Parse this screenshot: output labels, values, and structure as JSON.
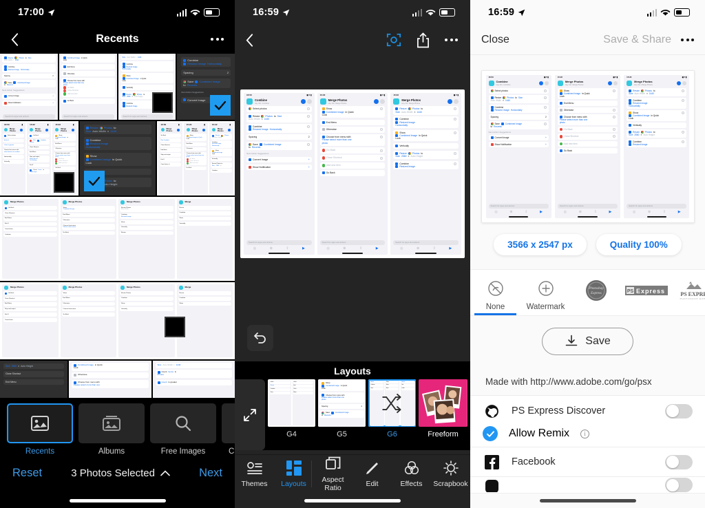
{
  "panel1": {
    "statusbar": {
      "time": "17:00",
      "location_icon": "location-arrow-icon",
      "signal_icon": "cellular-bars-icon",
      "wifi_icon": "wifi-icon",
      "battery_icon": "battery-icon"
    },
    "navbar": {
      "back_icon": "chevron-left-icon",
      "title": "Recents",
      "more_icon": "ellipsis-icon"
    },
    "tabs": [
      {
        "label": "Recents",
        "icon": "photos-icon",
        "selected": true
      },
      {
        "label": "Albums",
        "icon": "albums-icon",
        "selected": false
      },
      {
        "label": "Free Images",
        "icon": "search-icon",
        "selected": false
      },
      {
        "label": "Creative Cloud",
        "icon": "creative-cloud-icon",
        "selected": false
      }
    ],
    "actions": {
      "reset": "Reset",
      "selection": "3 Photos Selected",
      "chevron_icon": "chevron-up-icon",
      "next": "Next"
    }
  },
  "panel2": {
    "statusbar": {
      "time": "16:59"
    },
    "navbar": {
      "back_icon": "chevron-left-icon",
      "focus_icon": "focus-scan-icon",
      "share_icon": "share-icon",
      "more_icon": "ellipsis-icon"
    },
    "undo_icon": "undo-icon",
    "expand_icon": "expand-icon",
    "layouts_title": "Layouts",
    "layouts": [
      {
        "label": "G4",
        "selected": false
      },
      {
        "label": "G5",
        "selected": false
      },
      {
        "label": "G6",
        "selected": true
      },
      {
        "label": "Freeform",
        "selected": false
      }
    ],
    "bottom_nav": [
      {
        "label": "Themes",
        "icon": "themes-icon",
        "active": false
      },
      {
        "label": "Layouts",
        "icon": "layouts-icon",
        "active": true
      },
      {
        "label": "Aspect Ratio",
        "icon": "aspect-ratio-icon",
        "active": false
      },
      {
        "label": "Edit",
        "icon": "pencil-icon",
        "active": false
      },
      {
        "label": "Effects",
        "icon": "effects-icon",
        "active": false
      },
      {
        "label": "Scrapbook",
        "icon": "scrapbook-icon",
        "active": false
      }
    ]
  },
  "panel3": {
    "statusbar": {
      "time": "16:59"
    },
    "navbar": {
      "close": "Close",
      "save_share": "Save & Share",
      "more_icon": "ellipsis-icon"
    },
    "chips": [
      "3566 x 2547 px",
      "Quality 100%"
    ],
    "watermarks": [
      {
        "label": "None",
        "icon": "no-watermark-icon",
        "selected": true
      },
      {
        "label": "Watermark",
        "icon": "plus-circle-icon",
        "selected": false
      },
      {
        "label": "Photoshop Express",
        "icon": "ps-badge-icon",
        "selected": false
      },
      {
        "label": "PS Express",
        "icon": "ps-express-box-icon",
        "selected": false
      },
      {
        "label": "PS EXPRESS",
        "icon": "ps-express-mountain-icon",
        "selected": false
      }
    ],
    "save_button": {
      "label": "Save",
      "icon": "download-icon"
    },
    "made_with": "Made with http://www.adobe.com/go/psx",
    "share_rows": [
      {
        "label": "PS Express Discover",
        "icon": "globe-icon",
        "toggle": "off",
        "sub": {
          "label": "Allow Remix",
          "check_icon": "check-circle-icon",
          "info_icon": "info-icon"
        }
      },
      {
        "label": "Facebook",
        "icon": "facebook-icon",
        "toggle": "off"
      }
    ]
  },
  "colors": {
    "accent_blue": "#2196f3",
    "link_blue": "#3d9ae8",
    "chip_blue": "#1473e6",
    "dark_bg": "#000000",
    "panel2_bg": "#242424",
    "light_bg": "#fafafa"
  },
  "shortcuts": {
    "s1": {
      "time": "16:50",
      "title": "Combine",
      "subtitle": "Hey Siri, Combine",
      "rows": [
        [
          "Select photos"
        ],
        [
          "Resize",
          "Photos",
          "to",
          "Size",
          "Auto Width",
          "1440"
        ],
        [
          "Combine",
          "Resized Image",
          "Horizontally"
        ],
        [
          "Spacing",
          "2"
        ],
        [
          "Save",
          "Combined Image",
          "to",
          "Recents"
        ]
      ],
      "suggest_label": "Next Action Suggestions",
      "suggestions": [
        "Convert Image",
        "Show Notification"
      ],
      "search": "Search for apps and actions"
    },
    "s2": {
      "time": "15:22",
      "title": "Merge Photos",
      "subtitle": "Hey Siri, Merge Photos",
      "rows": [
        [
          "Show",
          "Combined Image",
          "in Quick Look"
        ],
        [
          "End Menu"
        ],
        [
          "Otherwise"
        ],
        [
          "Choose from menu with",
          "Please select more than one photo"
        ],
        [
          "Go Back"
        ],
        [
          "Close Shortcut"
        ],
        [
          "Add new item"
        ],
        [
          "Go Back"
        ]
      ],
      "search": "Search for apps and actions"
    },
    "s3": {
      "time": "15:22",
      "title": "Merge Photos",
      "subtitle": "Hey Siri, Merge Photos",
      "rows": [
        [
          "Resize",
          "Photos",
          "to",
          "Size",
          "Auto Width",
          "1440"
        ],
        [
          "Combine",
          "Resized Image",
          "Horizontally"
        ],
        [
          "Show",
          "Combined Image",
          "in Quick Look"
        ],
        [
          "Vertically"
        ],
        [
          "Resize",
          "Photos",
          "to",
          "Size",
          "2560",
          "Auto Height"
        ],
        [
          "Combine",
          "Resized Image"
        ]
      ],
      "search": "Search for apps and actions"
    }
  }
}
